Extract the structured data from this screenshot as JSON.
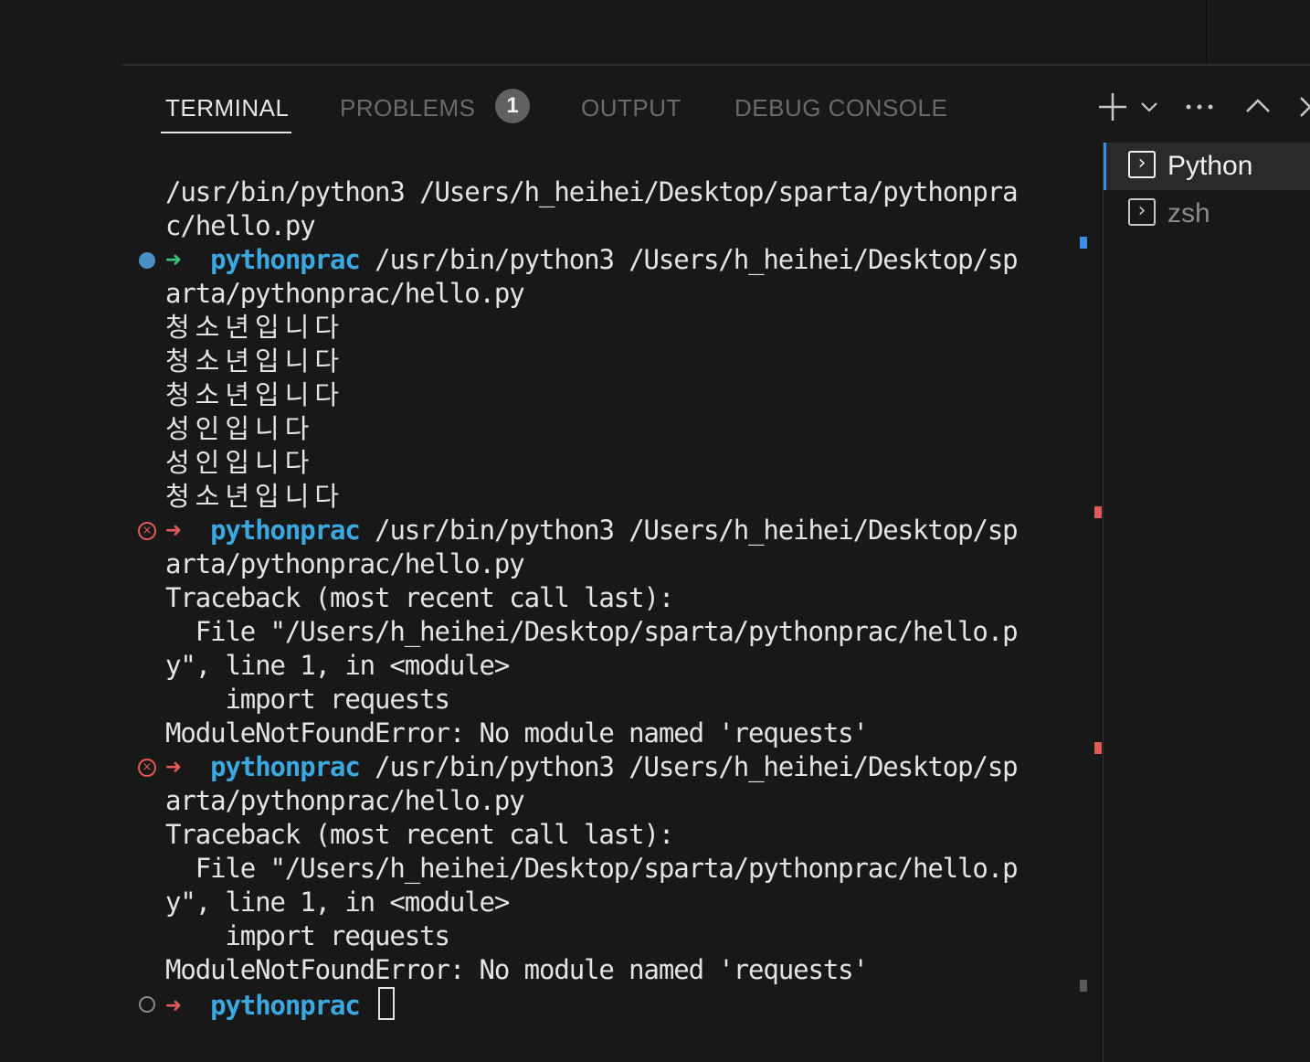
{
  "panel": {
    "tabs": [
      {
        "label": "TERMINAL",
        "active": true
      },
      {
        "label": "PROBLEMS",
        "active": false
      },
      {
        "label": "OUTPUT",
        "active": false
      },
      {
        "label": "DEBUG CONSOLE",
        "active": false
      }
    ],
    "problems_count": "1",
    "actions": {
      "new_terminal": "plus-icon",
      "launch_profile": "chevron-down-icon",
      "more_actions": "ellipsis-icon",
      "maximize": "chevron-up-icon",
      "close": "close-icon"
    }
  },
  "terminal": {
    "lines": [
      {
        "text": "/usr/bin/python3 /Users/h_heihei/Desktop/sparta/pythonpra"
      },
      {
        "text": "c/hello.py"
      },
      {
        "prompt": true,
        "status": "success",
        "arrow": "➜",
        "dir": "pythonprac",
        "text": " /usr/bin/python3 /Users/h_heihei/Desktop/sp"
      },
      {
        "text": "arta/pythonprac/hello.py"
      },
      {
        "text": "청소년입니다",
        "korean": true
      },
      {
        "text": "청소년입니다",
        "korean": true
      },
      {
        "text": "청소년입니다",
        "korean": true
      },
      {
        "text": "성인입니다",
        "korean": true
      },
      {
        "text": "성인입니다",
        "korean": true
      },
      {
        "text": "청소년입니다",
        "korean": true
      },
      {
        "prompt": true,
        "status": "error",
        "arrow": "➜",
        "dir": "pythonprac",
        "text": " /usr/bin/python3 /Users/h_heihei/Desktop/sp"
      },
      {
        "text": "arta/pythonprac/hello.py"
      },
      {
        "text": "Traceback (most recent call last):"
      },
      {
        "text": "  File \"/Users/h_heihei/Desktop/sparta/pythonprac/hello.p"
      },
      {
        "text": "y\", line 1, in <module>"
      },
      {
        "text": "    import requests"
      },
      {
        "text": "ModuleNotFoundError: No module named 'requests'"
      },
      {
        "prompt": true,
        "status": "error",
        "arrow": "➜",
        "dir": "pythonprac",
        "text": " /usr/bin/python3 /Users/h_heihei/Desktop/sp"
      },
      {
        "text": "arta/pythonprac/hello.py"
      },
      {
        "text": "Traceback (most recent call last):"
      },
      {
        "text": "  File \"/Users/h_heihei/Desktop/sparta/pythonprac/hello.p"
      },
      {
        "text": "y\", line 1, in <module>"
      },
      {
        "text": "    import requests"
      },
      {
        "text": "ModuleNotFoundError: No module named 'requests'"
      },
      {
        "prompt": true,
        "status": "idle",
        "arrow": "➜",
        "dir": "pythonprac",
        "text": " ",
        "cursor": true
      }
    ]
  },
  "terminal_list": {
    "items": [
      {
        "label": "Python",
        "icon": "terminal-icon",
        "active": true
      },
      {
        "label": "zsh",
        "icon": "terminal-icon",
        "active": false
      }
    ]
  },
  "colors": {
    "background": "#181818",
    "prompt_dir": "#3ba8e0",
    "arrow_success": "#3cc37a",
    "arrow_error": "#e05a5a",
    "active_tab_accent": "#3a8ee6"
  }
}
